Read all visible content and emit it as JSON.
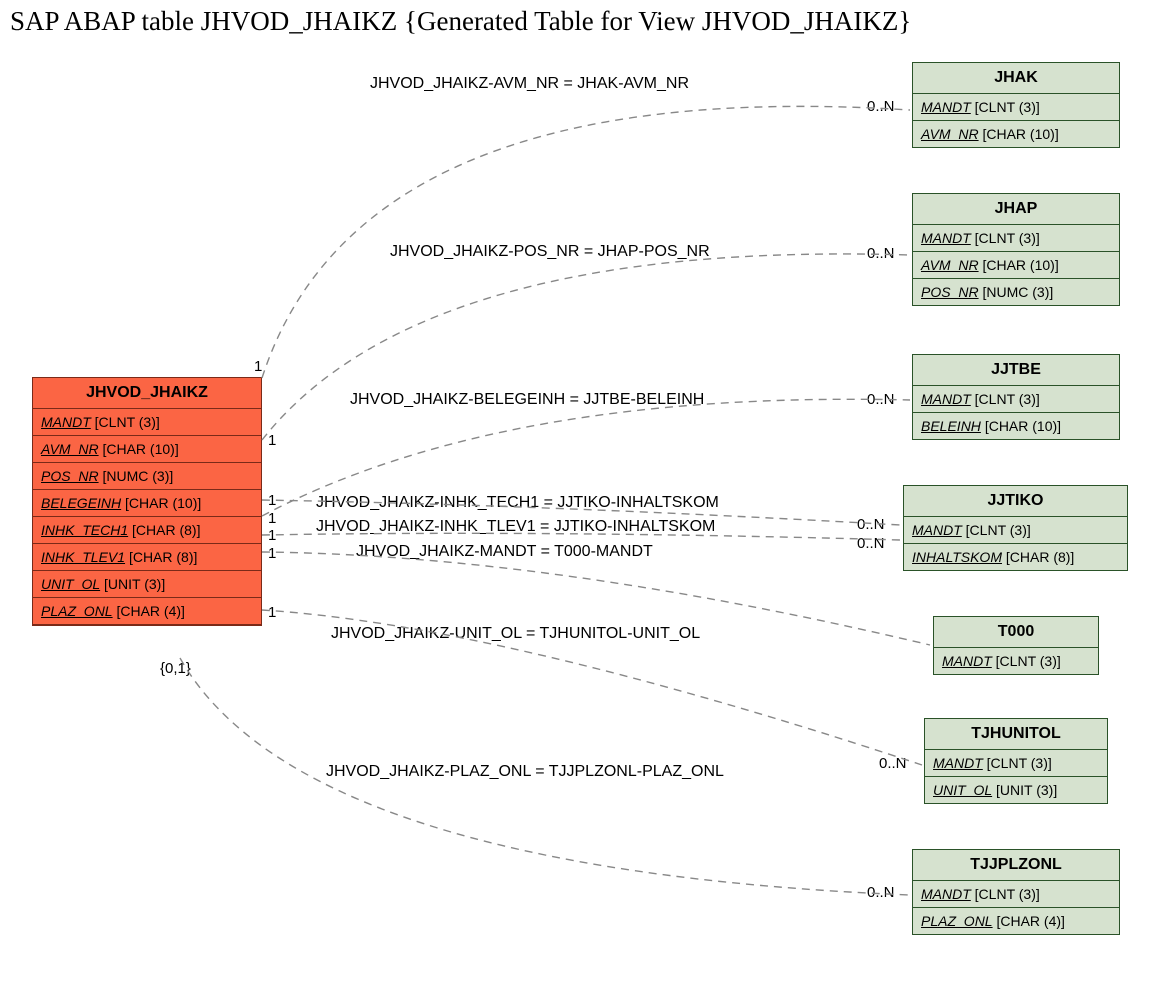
{
  "title": "SAP ABAP table JHVOD_JHAIKZ {Generated Table for View JHVOD_JHAIKZ}",
  "main_entity": {
    "name": "JHVOD_JHAIKZ",
    "fields": [
      {
        "name": "MANDT",
        "type": "[CLNT (3)]"
      },
      {
        "name": "AVM_NR",
        "type": "[CHAR (10)]"
      },
      {
        "name": "POS_NR",
        "type": "[NUMC (3)]"
      },
      {
        "name": "BELEGEINH",
        "type": "[CHAR (10)]"
      },
      {
        "name": "INHK_TECH1",
        "type": "[CHAR (8)]"
      },
      {
        "name": "INHK_TLEV1",
        "type": "[CHAR (8)]"
      },
      {
        "name": "UNIT_OL",
        "type": "[UNIT (3)]"
      },
      {
        "name": "PLAZ_ONL",
        "type": "[CHAR (4)]"
      }
    ]
  },
  "targets": [
    {
      "name": "JHAK",
      "fields": [
        {
          "name": "MANDT",
          "type": "[CLNT (3)]"
        },
        {
          "name": "AVM_NR",
          "type": "[CHAR (10)]"
        }
      ]
    },
    {
      "name": "JHAP",
      "fields": [
        {
          "name": "MANDT",
          "type": "[CLNT (3)]"
        },
        {
          "name": "AVM_NR",
          "type": "[CHAR (10)]"
        },
        {
          "name": "POS_NR",
          "type": "[NUMC (3)]"
        }
      ]
    },
    {
      "name": "JJTBE",
      "fields": [
        {
          "name": "MANDT",
          "type": "[CLNT (3)]"
        },
        {
          "name": "BELEINH",
          "type": "[CHAR (10)]"
        }
      ]
    },
    {
      "name": "JJTIKO",
      "fields": [
        {
          "name": "MANDT",
          "type": "[CLNT (3)]"
        },
        {
          "name": "INHALTSKOM",
          "type": "[CHAR (8)]"
        }
      ]
    },
    {
      "name": "T000",
      "fields": [
        {
          "name": "MANDT",
          "type": "[CLNT (3)]"
        }
      ]
    },
    {
      "name": "TJHUNITOL",
      "fields": [
        {
          "name": "MANDT",
          "type": "[CLNT (3)]"
        },
        {
          "name": "UNIT_OL",
          "type": "[UNIT (3)]"
        }
      ]
    },
    {
      "name": "TJJPLZONL",
      "fields": [
        {
          "name": "MANDT",
          "type": "[CLNT (3)]"
        },
        {
          "name": "PLAZ_ONL",
          "type": "[CHAR (4)]"
        }
      ]
    }
  ],
  "edges": [
    {
      "label": "JHVOD_JHAIKZ-AVM_NR = JHAK-AVM_NR",
      "left_card": "1",
      "right_card": "0..N"
    },
    {
      "label": "JHVOD_JHAIKZ-POS_NR = JHAP-POS_NR",
      "left_card": "1",
      "right_card": "0..N"
    },
    {
      "label": "JHVOD_JHAIKZ-BELEGEINH = JJTBE-BELEINH",
      "left_card": "1",
      "right_card": "0..N"
    },
    {
      "label": "JHVOD_JHAIKZ-INHK_TECH1 = JJTIKO-INHALTSKOM",
      "left_card": "1",
      "right_card": "0..N"
    },
    {
      "label": "JHVOD_JHAIKZ-INHK_TLEV1 = JJTIKO-INHALTSKOM",
      "left_card": "1",
      "right_card": "0..N"
    },
    {
      "label": "JHVOD_JHAIKZ-MANDT = T000-MANDT",
      "left_card": "1",
      "right_card": ""
    },
    {
      "label": "JHVOD_JHAIKZ-UNIT_OL = TJHUNITOL-UNIT_OL",
      "left_card": "1",
      "right_card": "0..N"
    },
    {
      "label": "JHVOD_JHAIKZ-PLAZ_ONL = TJJPLZONL-PLAZ_ONL",
      "left_card": "{0,1}",
      "right_card": "0..N"
    }
  ]
}
